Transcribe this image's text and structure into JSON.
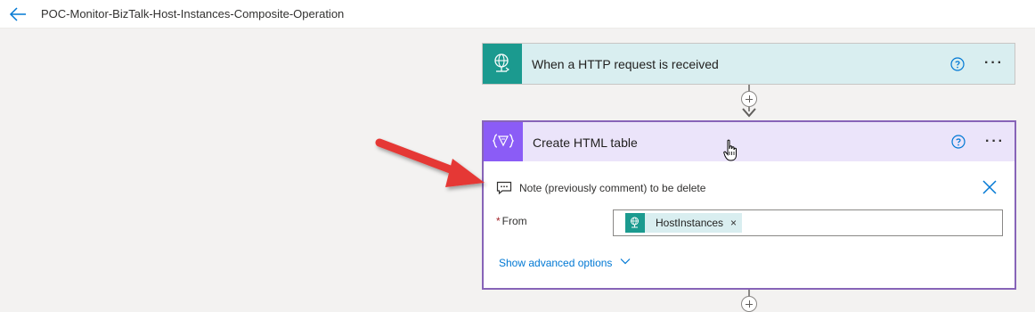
{
  "header": {
    "title": "POC-Monitor-BizTalk-Host-Instances-Composite-Operation",
    "back_icon": "back-arrow-icon"
  },
  "trigger": {
    "title": "When a HTTP request is received",
    "icon": "http-request-globe-icon",
    "color": "#1b9a8f",
    "header_bg": "#d9eef0",
    "help_icon": "help-circle-icon",
    "more_label": "···"
  },
  "action": {
    "title": "Create HTML table",
    "icon": "data-operation-icon",
    "color": "#8b5cf6",
    "header_bg": "#ebe4fa",
    "border_color": "#8764b8",
    "help_icon": "help-circle-icon",
    "more_label": "···",
    "note": {
      "icon": "comment-icon",
      "text": "Note (previously comment) to be delete",
      "close_icon": "close-icon"
    },
    "from": {
      "required_mark": "*",
      "label": "From",
      "token": {
        "label": "HostInstances",
        "remove": "×",
        "icon": "http-request-globe-icon"
      }
    },
    "advanced": {
      "label": "Show advanced options",
      "icon": "chevron-down-icon"
    }
  },
  "annotation": {
    "arrow_color": "#e53935"
  }
}
